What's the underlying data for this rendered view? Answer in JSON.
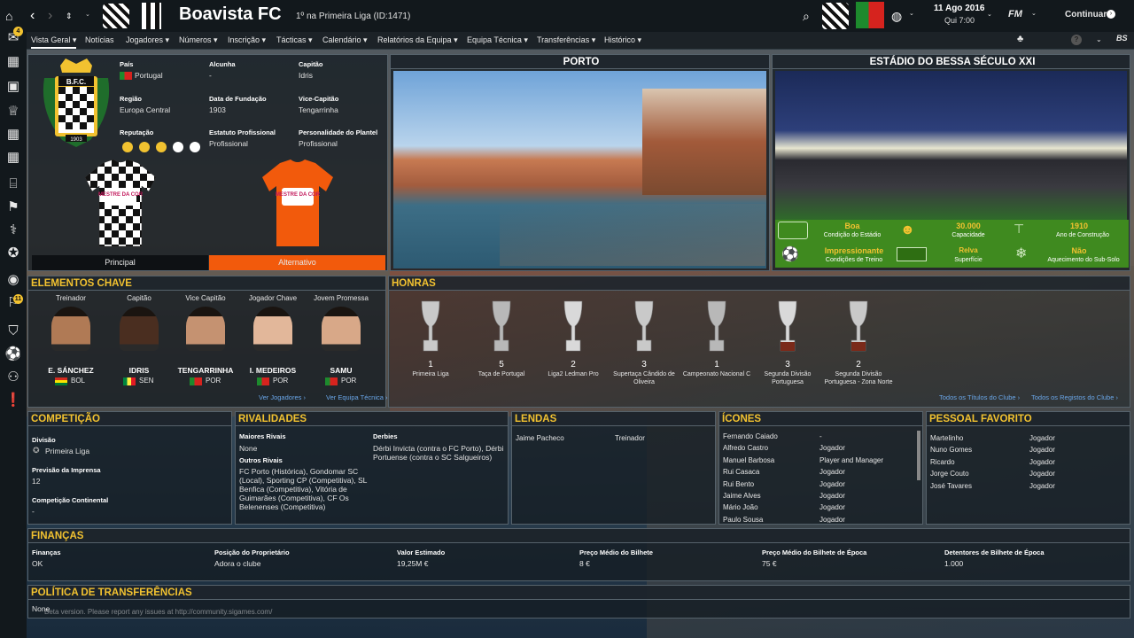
{
  "header": {
    "club_name": "Boavista FC",
    "subtitle": "1º na Primeira Liga (ID:1471)",
    "date": "11 Ago 2016",
    "time": "Qui 7:00",
    "fm": "FM",
    "continue_label": "Continuar",
    "badge_count": "4",
    "mail_count": "11",
    "bs": "BS"
  },
  "menu": [
    "Vista Geral",
    "Notícias",
    "Jogadores",
    "Números",
    "Inscrição",
    "Tácticas",
    "Calendário",
    "Relatórios da Equipa",
    "Equipa Técnica",
    "Transferências",
    "Histórico"
  ],
  "info": {
    "pais_label": "País",
    "pais": "Portugal",
    "alcunha_label": "Alcunha",
    "alcunha": "-",
    "capitao_label": "Capitão",
    "capitao": "Idris",
    "regiao_label": "Região",
    "regiao": "Europa Central",
    "fundacao_label": "Data de Fundação",
    "fundacao": "1903",
    "vice_label": "Vice-Capitão",
    "vice": "Tengarrinha",
    "reputacao_label": "Reputação",
    "estatuto_label": "Estatuto Profissional",
    "estatuto": "Profissional",
    "personalidade_label": "Personalidade do Plantel",
    "personalidade": "Profissional",
    "crest_text": "B.F.C.",
    "crest_year": "1903",
    "kit_home": "Principal",
    "kit_away": "Alternativo",
    "kit_sponsor": "MESTRE DA COR",
    "reputation_stars": 3
  },
  "city": {
    "title": "PORTO"
  },
  "stadium": {
    "title": "ESTÁDIO DO BESSA SÉCULO XXI",
    "stats": [
      {
        "value": "Boa",
        "label": "Condição do Estádio"
      },
      {
        "value": "30.000",
        "label": "Capacidade"
      },
      {
        "value": "1910",
        "label": "Ano de Construção"
      },
      {
        "value": "Impressionante",
        "label": "Condições de Treino"
      },
      {
        "value": "Relva",
        "label": "Superfície"
      },
      {
        "value": "Não",
        "label": "Aquecimento do Sub-Solo"
      }
    ]
  },
  "key": {
    "title": "ELEMENTOS CHAVE",
    "people": [
      {
        "role": "Treinador",
        "name": "E. SÁNCHEZ",
        "nat": "BOL"
      },
      {
        "role": "Capitão",
        "name": "IDRIS",
        "nat": "SEN"
      },
      {
        "role": "Vice Capitão",
        "name": "TENGARRINHA",
        "nat": "POR"
      },
      {
        "role": "Jogador Chave",
        "name": "I. MEDEIROS",
        "nat": "POR"
      },
      {
        "role": "Jovem Promessa",
        "name": "SAMU",
        "nat": "POR"
      }
    ],
    "link1": "Ver Jogadores",
    "link2": "Ver Equipa Técnica"
  },
  "honours": {
    "title": "HONRAS",
    "items": [
      {
        "count": "1",
        "name": "Primeira Liga"
      },
      {
        "count": "5",
        "name": "Taça de Portugal"
      },
      {
        "count": "2",
        "name": "Liga2 Ledman Pro"
      },
      {
        "count": "3",
        "name": "Supertaça Cândido de Oliveira"
      },
      {
        "count": "1",
        "name": "Campeonato Nacional C"
      },
      {
        "count": "3",
        "name": "Segunda Divisão Portuguesa"
      },
      {
        "count": "2",
        "name": "Segunda Divisão Portuguesa - Zona Norte"
      }
    ],
    "link1": "Todos os Títulos do Clube",
    "link2": "Todos os Registos do Clube"
  },
  "competition": {
    "title": "COMPETIÇÃO",
    "divisao_label": "Divisão",
    "divisao": "Primeira Liga",
    "previsao_label": "Previsão da Imprensa",
    "previsao": "12",
    "continental_label": "Competição Continental",
    "continental": "-"
  },
  "rivals": {
    "title": "RIVALIDADES",
    "maiores_label": "Maiores Rivais",
    "maiores": "None",
    "outros_label": "Outros Rivais",
    "outros": "FC Porto (Histórica), Gondomar SC (Local), Sporting CP (Competitiva), SL Benfica (Competitiva), Vitória de Guimarães (Competitiva), CF Os Belenenses (Competitiva)",
    "derbies_label": "Derbies",
    "derbies": "Dérbi Invicta (contra o FC Porto), Dérbi Portuense (contra o SC Salgueiros)"
  },
  "legends": {
    "title": "LENDAS",
    "rows": [
      {
        "name": "Jaime Pacheco",
        "role": "Treinador"
      }
    ]
  },
  "icons_panel": {
    "title": "ÍCONES",
    "rows": [
      {
        "name": "Fernando Caiado",
        "role": "-"
      },
      {
        "name": "Alfredo Castro",
        "role": "Jogador"
      },
      {
        "name": "Manuel Barbosa",
        "role": "Player and Manager"
      },
      {
        "name": "Rui Casaca",
        "role": "Jogador"
      },
      {
        "name": "Rui Bento",
        "role": "Jogador"
      },
      {
        "name": "Jaime Alves",
        "role": "Jogador"
      },
      {
        "name": "Mário João",
        "role": "Jogador"
      },
      {
        "name": "Paulo Sousa",
        "role": "Jogador"
      }
    ]
  },
  "favourite": {
    "title": "PESSOAL FAVORITO",
    "rows": [
      {
        "name": "Martelinho",
        "role": "Jogador"
      },
      {
        "name": "Nuno Gomes",
        "role": "Jogador"
      },
      {
        "name": "Ricardo",
        "role": "Jogador"
      },
      {
        "name": "Jorge Couto",
        "role": "Jogador"
      },
      {
        "name": "José Tavares",
        "role": "Jogador"
      }
    ]
  },
  "finance": {
    "title": "FINANÇAS",
    "cols": [
      {
        "label": "Finanças",
        "value": "OK"
      },
      {
        "label": "Posição do Proprietário",
        "value": "Adora o clube"
      },
      {
        "label": "Valor Estimado",
        "value": "19,25M €"
      },
      {
        "label": "Preço Médio do Bilhete",
        "value": "8 €"
      },
      {
        "label": "Preço Médio do Bilhete de Época",
        "value": "75 €"
      },
      {
        "label": "Detentores de Bilhete de Época",
        "value": "1.000"
      }
    ]
  },
  "transfer": {
    "title": "POLÍTICA DE TRANSFERÊNCIAS",
    "value": "None"
  },
  "footer": {
    "beta": "Beta version. Please report any issues at http://community.sigames.com/"
  },
  "colors": {
    "accent": "#f2c230",
    "away_kit": "#f25a0c",
    "stadium_green": "#3f8a1f",
    "link": "#6aa6e8"
  }
}
